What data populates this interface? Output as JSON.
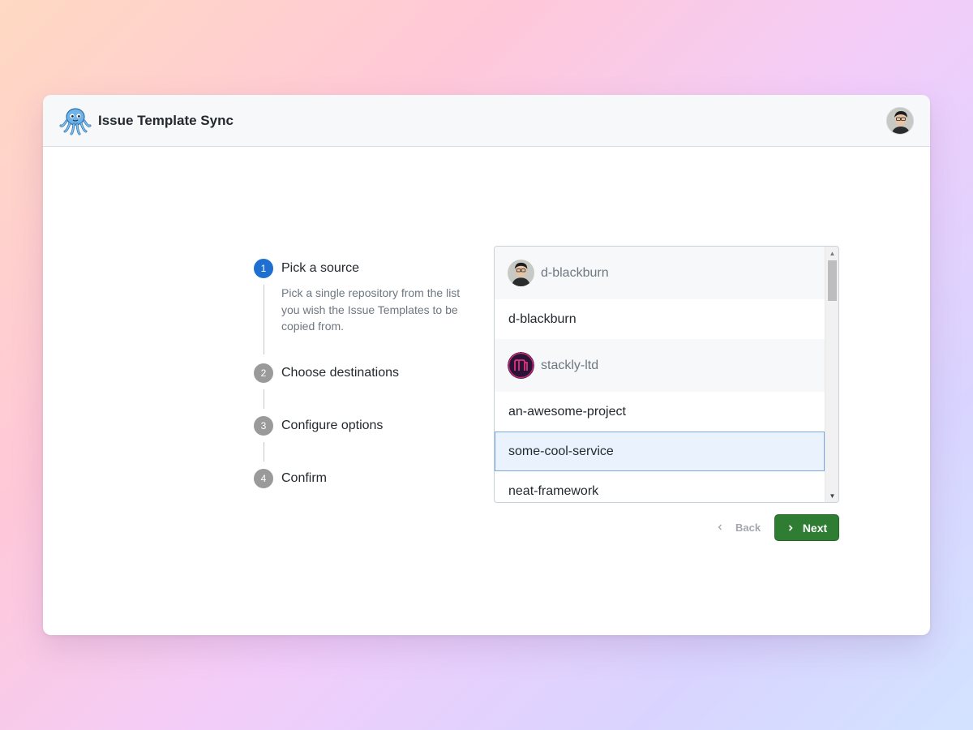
{
  "app": {
    "title": "Issue Template Sync",
    "logo_icon": "octopus-logo-icon",
    "user_avatar": "user-avatar"
  },
  "steps": [
    {
      "number": "1",
      "title": "Pick a source",
      "description": "Pick a single repository from the list you wish the Issue Templates to be copied from.",
      "active": true
    },
    {
      "number": "2",
      "title": "Choose destinations",
      "active": false
    },
    {
      "number": "3",
      "title": "Configure options",
      "active": false
    },
    {
      "number": "4",
      "title": "Confirm",
      "active": false
    }
  ],
  "repo_list": {
    "groups": [
      {
        "owner": "d-blackburn",
        "repos": [
          "d-blackburn"
        ]
      },
      {
        "owner": "stackly-ltd",
        "repos": [
          "an-awesome-project",
          "some-cool-service",
          "neat-framework"
        ]
      }
    ],
    "selected": "some-cool-service"
  },
  "nav": {
    "back_label": "Back",
    "next_label": "Next"
  },
  "colors": {
    "accent": "#1f6fd1",
    "next_button": "#2e7d32",
    "selected_bg": "#eaf3fd"
  }
}
